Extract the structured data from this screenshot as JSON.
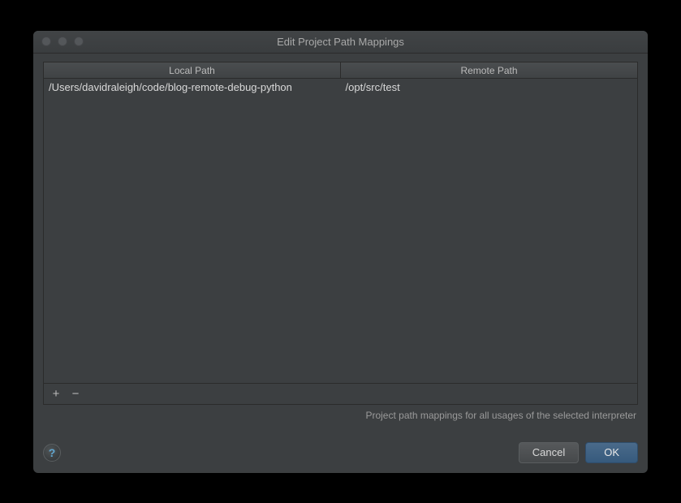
{
  "window": {
    "title": "Edit Project Path Mappings"
  },
  "table": {
    "headers": {
      "local": "Local Path",
      "remote": "Remote Path"
    },
    "rows": [
      {
        "local": "/Users/davidraleigh/code/blog-remote-debug-python",
        "remote": "/opt/src/test"
      }
    ]
  },
  "toolbar": {
    "add_symbol": "+",
    "remove_symbol": "−"
  },
  "hint": "Project path mappings for all usages of the selected interpreter",
  "footer": {
    "help_symbol": "?",
    "cancel_label": "Cancel",
    "ok_label": "OK"
  }
}
